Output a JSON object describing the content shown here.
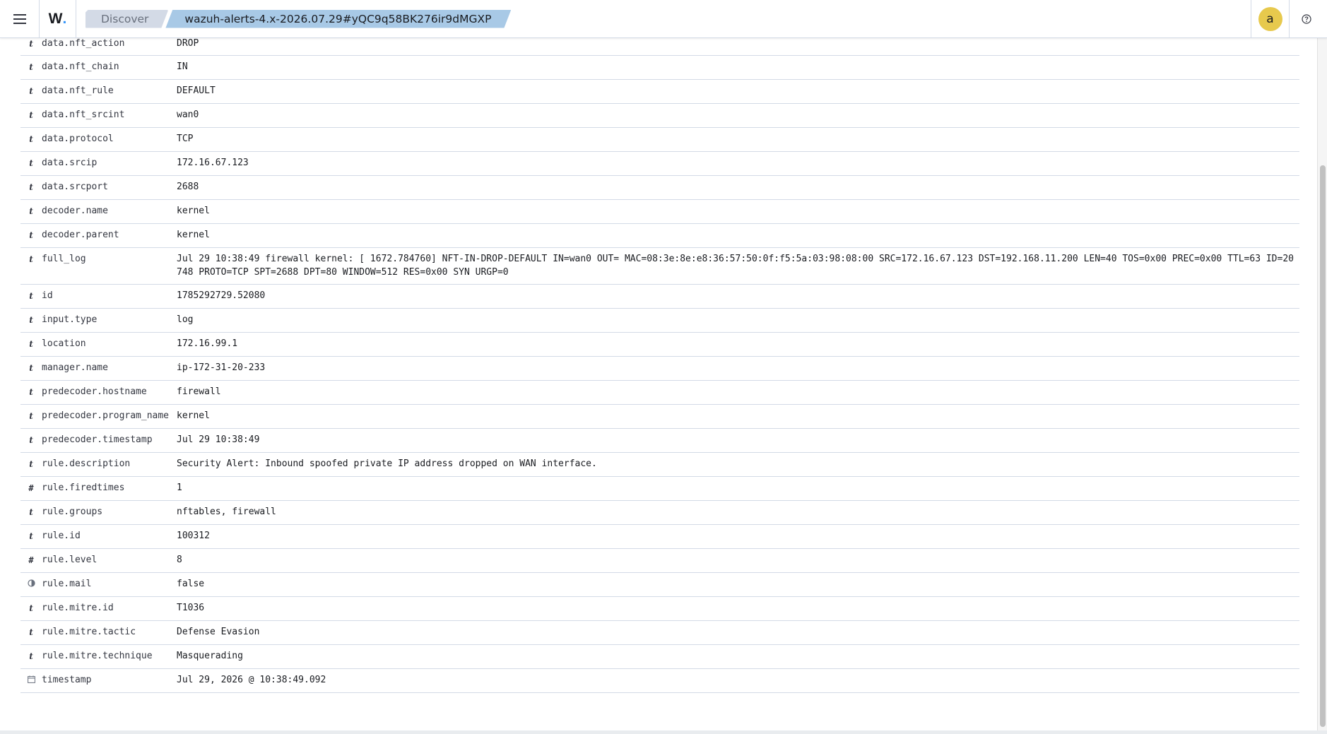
{
  "header": {
    "logo_text": "W",
    "logo_dot": ".",
    "breadcrumbs": [
      "Discover",
      "wazuh-alerts-4.x-2026.07.29#yQC9q58BK276ir9dMGXP"
    ],
    "avatar_letter": "a"
  },
  "fields": [
    {
      "type": "t",
      "name": "data.nft_action",
      "value": "DROP"
    },
    {
      "type": "t",
      "name": "data.nft_chain",
      "value": "IN"
    },
    {
      "type": "t",
      "name": "data.nft_rule",
      "value": "DEFAULT"
    },
    {
      "type": "t",
      "name": "data.nft_srcint",
      "value": "wan0"
    },
    {
      "type": "t",
      "name": "data.protocol",
      "value": "TCP"
    },
    {
      "type": "t",
      "name": "data.srcip",
      "value": "172.16.67.123"
    },
    {
      "type": "t",
      "name": "data.srcport",
      "value": "2688"
    },
    {
      "type": "t",
      "name": "decoder.name",
      "value": "kernel"
    },
    {
      "type": "t",
      "name": "decoder.parent",
      "value": "kernel"
    },
    {
      "type": "t",
      "name": "full_log",
      "value": "Jul 29 10:38:49 firewall kernel: [ 1672.784760] NFT-IN-DROP-DEFAULT IN=wan0 OUT= MAC=08:3e:8e:e8:36:57:50:0f:f5:5a:03:98:08:00 SRC=172.16.67.123 DST=192.168.11.200 LEN=40 TOS=0x00 PREC=0x00 TTL=63 ID=20748 PROTO=TCP SPT=2688 DPT=80 WINDOW=512 RES=0x00 SYN URGP=0"
    },
    {
      "type": "t",
      "name": "id",
      "value": "1785292729.52080"
    },
    {
      "type": "t",
      "name": "input.type",
      "value": "log"
    },
    {
      "type": "t",
      "name": "location",
      "value": "172.16.99.1"
    },
    {
      "type": "t",
      "name": "manager.name",
      "value": "ip-172-31-20-233"
    },
    {
      "type": "t",
      "name": "predecoder.hostname",
      "value": "firewall"
    },
    {
      "type": "t",
      "name": "predecoder.program_name",
      "value": "kernel"
    },
    {
      "type": "t",
      "name": "predecoder.timestamp",
      "value": "Jul 29 10:38:49"
    },
    {
      "type": "t",
      "name": "rule.description",
      "value": "Security Alert: Inbound spoofed private IP address dropped on WAN interface."
    },
    {
      "type": "#",
      "name": "rule.firedtimes",
      "value": "1"
    },
    {
      "type": "t",
      "name": "rule.groups",
      "value": "nftables, firewall"
    },
    {
      "type": "t",
      "name": "rule.id",
      "value": "100312"
    },
    {
      "type": "#",
      "name": "rule.level",
      "value": "8"
    },
    {
      "type": "bool",
      "name": "rule.mail",
      "value": "false"
    },
    {
      "type": "t",
      "name": "rule.mitre.id",
      "value": "T1036"
    },
    {
      "type": "t",
      "name": "rule.mitre.tactic",
      "value": "Defense Evasion"
    },
    {
      "type": "t",
      "name": "rule.mitre.technique",
      "value": "Masquerading"
    },
    {
      "type": "date",
      "name": "timestamp",
      "value": "Jul 29, 2026 @ 10:38:49.092"
    }
  ]
}
